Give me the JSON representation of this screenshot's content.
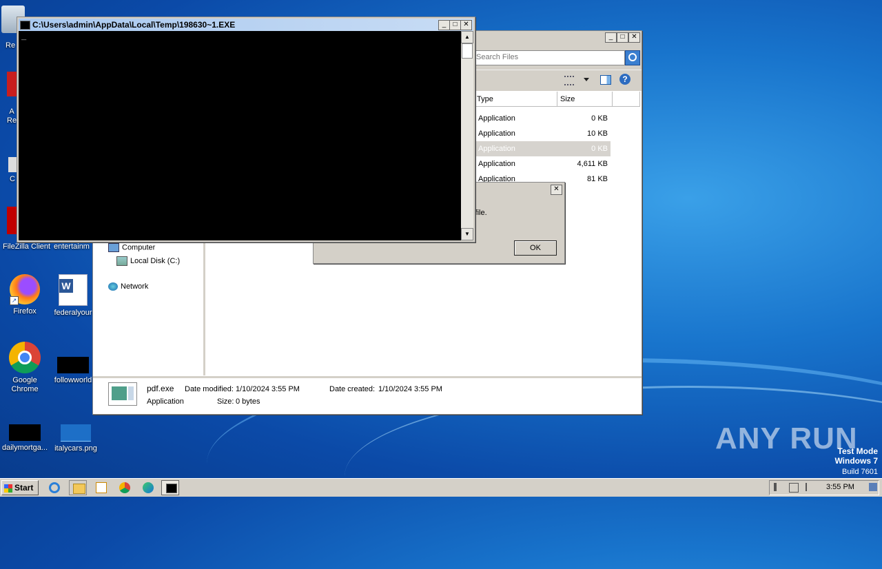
{
  "desktop": {
    "icons": [
      {
        "label": "Re"
      },
      {
        "label": "A\nRe"
      },
      {
        "label": "C"
      },
      {
        "label": "FileZilla Client"
      },
      {
        "label": "entertainm"
      },
      {
        "label": "Firefox"
      },
      {
        "label": "federalyour"
      },
      {
        "label": "Google\nChrome"
      },
      {
        "label": "followworld"
      },
      {
        "label": "dailymortga..."
      },
      {
        "label": "italycars.png"
      }
    ],
    "watermark": {
      "brand": "ANY RUN",
      "mode": "Test Mode",
      "os": "Windows 7",
      "build": "Build 7601"
    }
  },
  "console": {
    "title": "C:\\Users\\admin\\AppData\\Local\\Temp\\198630~1.EXE",
    "cursor": "_"
  },
  "explorer": {
    "search_placeholder": "Search Files",
    "columns": {
      "type": "Type",
      "size": "Size"
    },
    "rows": [
      {
        "type": "Application",
        "size": "0 KB"
      },
      {
        "type": "Application",
        "size": "10 KB"
      },
      {
        "type": "Application",
        "size": "0 KB"
      },
      {
        "type": "Application",
        "size": "4,611 KB"
      },
      {
        "type": "Application",
        "size": "81 KB"
      }
    ],
    "nav": {
      "computer": "Computer",
      "local_disk": "Local Disk (C:)",
      "network": "Network"
    },
    "details": {
      "name": "pdf.exe",
      "kind": "Application",
      "modified_label": "Date modified:",
      "modified": "1/10/2024 3:55 PM",
      "created_label": "Date created:",
      "created": "1/10/2024 3:55 PM",
      "size_label": "Size:",
      "size": "0 bytes"
    }
  },
  "dialog": {
    "message": "s file.",
    "ok": "OK"
  },
  "taskbar": {
    "start": "Start",
    "clock": "3:55 PM"
  },
  "colors": {
    "accent": "#1874cc",
    "selection": "#d6d3ce"
  }
}
